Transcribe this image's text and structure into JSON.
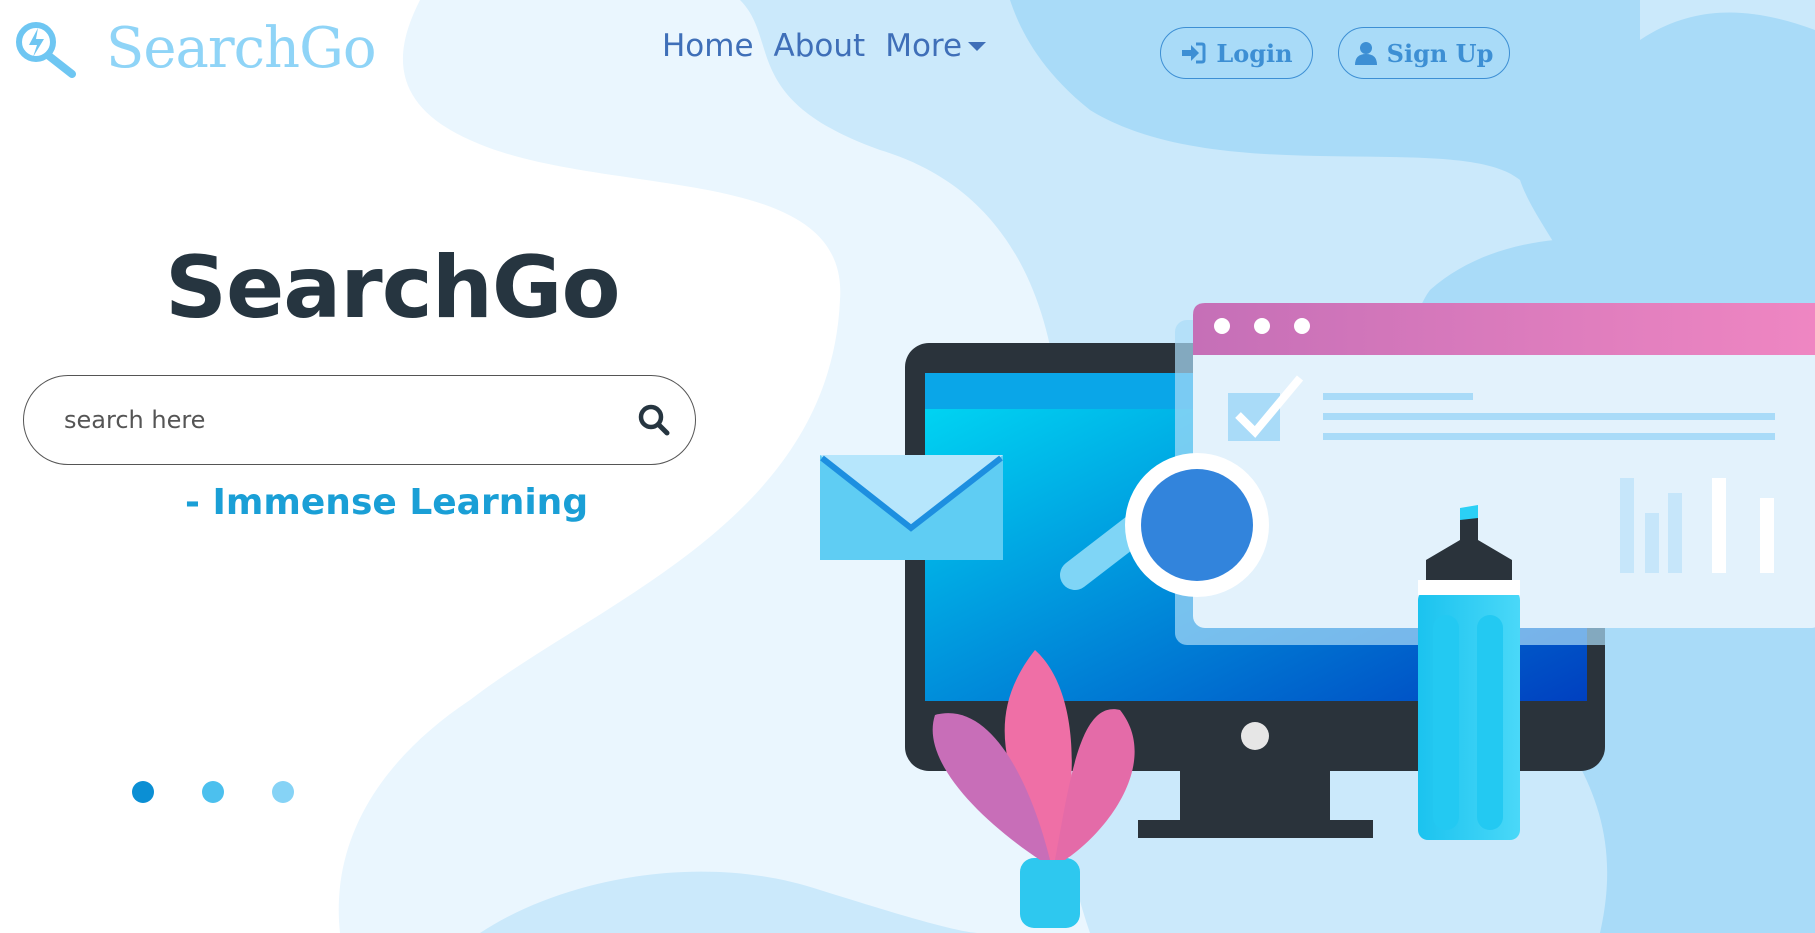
{
  "header": {
    "brand_name": "SearchGo",
    "nav": [
      {
        "label": "Home"
      },
      {
        "label": "About"
      },
      {
        "label": "More"
      }
    ],
    "login_label": "Login",
    "signup_label": "Sign Up"
  },
  "hero": {
    "title": "SearchGo",
    "search_placeholder": "search here",
    "tagline": "- Immense Learning"
  },
  "carousel": {
    "slide_count": 3,
    "active_index": 0
  },
  "colors": {
    "brand": "#8fd4f7",
    "nav_text": "#3f6fb8",
    "button_accent": "#3d8fd4",
    "title_text": "#263540",
    "tagline": "#1a9fd6",
    "dot_active": "#0b8fd4",
    "dot_2": "#4cc0ee",
    "dot_3": "#86d3f6"
  }
}
